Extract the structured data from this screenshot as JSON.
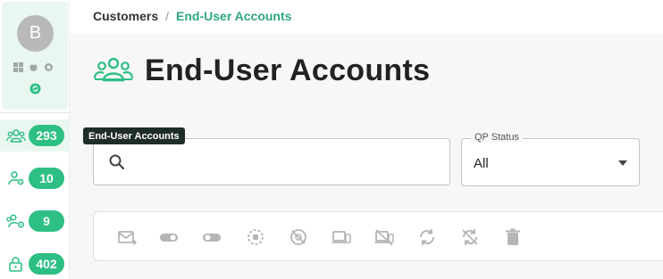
{
  "user": {
    "avatar_letter": "B"
  },
  "breadcrumb": {
    "root": "Customers",
    "separator": "/",
    "current": "End-User Accounts"
  },
  "page": {
    "title": "End-User Accounts",
    "title_icon": "users-group-icon"
  },
  "tooltip": {
    "text": "End-User Accounts"
  },
  "sidebar": {
    "items": [
      {
        "icon": "users-group-icon",
        "count": "293",
        "active": true
      },
      {
        "icon": "user-settings-icon",
        "count": "10",
        "active": false
      },
      {
        "icon": "group-settings-icon",
        "count": "9",
        "active": false
      },
      {
        "icon": "lock-icon",
        "count": "402",
        "active": false
      }
    ]
  },
  "search": {
    "placeholder": "",
    "value": ""
  },
  "qp_status": {
    "label": "QP Status",
    "value": "All"
  },
  "toolbar": {
    "buttons": [
      "mail-forward-icon",
      "toggle-off-icon",
      "toggle-off-icon",
      "timer-icon",
      "block-icon",
      "devices-icon",
      "devices-off-icon",
      "sync-icon",
      "sync-off-icon",
      "trash-icon"
    ]
  },
  "colors": {
    "accent": "#2ebf85",
    "accent_light": "#e9f7f0",
    "icon_gray": "#b5b5b5"
  }
}
